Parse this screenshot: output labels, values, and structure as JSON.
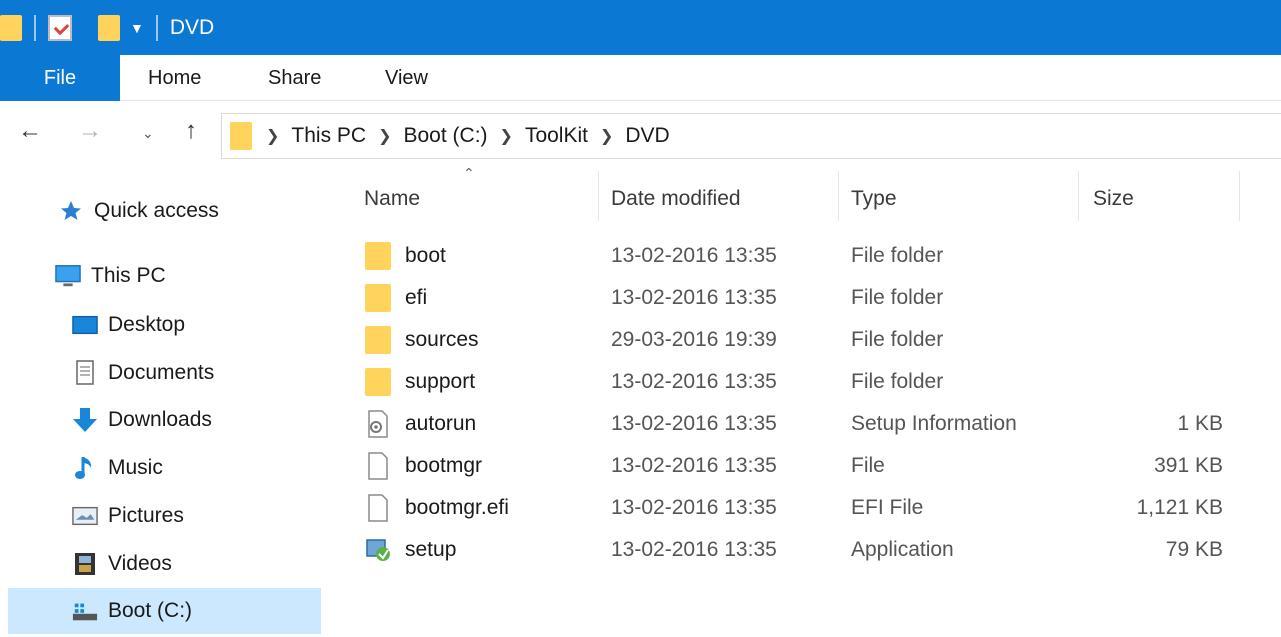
{
  "window": {
    "title": "DVD"
  },
  "ribbon": {
    "tabs": [
      "File",
      "Home",
      "Share",
      "View"
    ]
  },
  "navigation": {
    "back_icon": "arrow-left-icon",
    "forward_icon": "arrow-right-icon",
    "recent_icon": "chevron-down-icon",
    "up_icon": "arrow-up-icon"
  },
  "address": {
    "crumbs": [
      "This PC",
      "Boot (C:)",
      "ToolKit",
      "DVD"
    ]
  },
  "sidebar": {
    "items": [
      {
        "label": "Quick access",
        "icon": "star-icon"
      },
      {
        "label": "This PC",
        "icon": "monitor-icon"
      },
      {
        "label": "Desktop",
        "icon": "desktop-icon"
      },
      {
        "label": "Documents",
        "icon": "documents-icon"
      },
      {
        "label": "Downloads",
        "icon": "download-arrow-icon"
      },
      {
        "label": "Music",
        "icon": "music-note-icon"
      },
      {
        "label": "Pictures",
        "icon": "pictures-icon"
      },
      {
        "label": "Videos",
        "icon": "film-icon"
      },
      {
        "label": "Boot (C:)",
        "icon": "drive-icon"
      }
    ]
  },
  "columns": {
    "name": "Name",
    "date": "Date modified",
    "type": "Type",
    "size": "Size"
  },
  "files": [
    {
      "name": "boot",
      "date": "13-02-2016 13:35",
      "type": "File folder",
      "size": "",
      "icon": "folder-icon"
    },
    {
      "name": "efi",
      "date": "13-02-2016 13:35",
      "type": "File folder",
      "size": "",
      "icon": "folder-icon"
    },
    {
      "name": "sources",
      "date": "29-03-2016 19:39",
      "type": "File folder",
      "size": "",
      "icon": "folder-icon"
    },
    {
      "name": "support",
      "date": "13-02-2016 13:35",
      "type": "File folder",
      "size": "",
      "icon": "folder-icon"
    },
    {
      "name": "autorun",
      "date": "13-02-2016 13:35",
      "type": "Setup Information",
      "size": "1 KB",
      "icon": "gear-file-icon"
    },
    {
      "name": "bootmgr",
      "date": "13-02-2016 13:35",
      "type": "File",
      "size": "391 KB",
      "icon": "blank-file-icon"
    },
    {
      "name": "bootmgr.efi",
      "date": "13-02-2016 13:35",
      "type": "EFI File",
      "size": "1,121 KB",
      "icon": "blank-file-icon"
    },
    {
      "name": "setup",
      "date": "13-02-2016 13:35",
      "type": "Application",
      "size": "79 KB",
      "icon": "setup-app-icon"
    }
  ],
  "colors": {
    "accent": "#0b78d4",
    "selection": "#cce8ff",
    "folder": "#ffd35c"
  }
}
